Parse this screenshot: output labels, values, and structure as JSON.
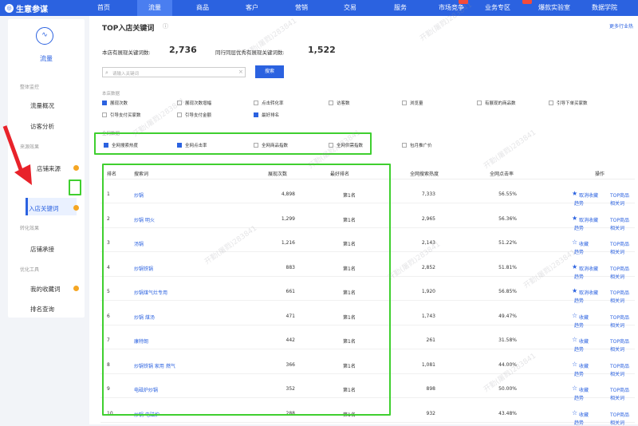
{
  "app": {
    "logo": "生意参谋"
  },
  "nav": [
    "首页",
    "流量",
    "商品",
    "客户",
    "营销",
    "交易",
    "服务",
    "市场竞争",
    "业务专区",
    "爆款实验室",
    "数据学院"
  ],
  "nav_active": 1,
  "sidebar": {
    "title": "流量",
    "sections": [
      "整体监控",
      "来源效果",
      "转化效果",
      "优化工具"
    ],
    "items": [
      "流量概况",
      "访客分析",
      "店铺来源",
      "入店关键词",
      "店铺承接",
      "我的收藏词",
      "排名查询"
    ],
    "active_item": "入店关键词"
  },
  "page": {
    "title": "TOP入店关键词",
    "more_link": "更多行业热",
    "stat1_label": "本店有展现关键词数:",
    "stat1_value": "2,736",
    "stat2_label": "同行同层优秀有展现关键词数:",
    "stat2_value": "1,522",
    "search_placeholder": "请输入关键词",
    "search_button": "搜索",
    "metrics_group_label": "本店数据",
    "metrics_row1": [
      "展现次数",
      "展现次数增幅",
      "点击转化率",
      "访客数",
      "浏览量",
      "有展现的商品数",
      "引导下单买家数"
    ],
    "metrics_row2": [
      "引导支付买家数",
      "引导支付金额",
      "最好排名"
    ],
    "metrics_row1_checked": [
      true,
      false,
      false,
      false,
      false,
      false,
      false
    ],
    "metrics_row2_checked": [
      false,
      false,
      true
    ],
    "global_group_label": "全网数据",
    "global_metrics": [
      "全网搜索热度",
      "全网点击率",
      "全网商品指数",
      "全网供需指数",
      "包月推广价"
    ],
    "global_checked": [
      true,
      true,
      false,
      false,
      false
    ]
  },
  "table": {
    "headers": [
      "排名",
      "搜索词",
      "展现次数",
      "最好排名",
      "全网搜索热度",
      "全网点击率",
      "操作"
    ],
    "rows": [
      {
        "rank": "1",
        "term": "炒锅",
        "impr": "4,898",
        "best": "第1名",
        "heat": "7,333",
        "ctr": "56.55%",
        "fav": "取消收藏",
        "fav_on": true,
        "trend": "趋势",
        "top": "TOP商品",
        "rel": "相关词"
      },
      {
        "rank": "2",
        "term": "炒锅 明火",
        "impr": "1,299",
        "best": "第1名",
        "heat": "2,965",
        "ctr": "56.36%",
        "fav": "取消收藏",
        "fav_on": true,
        "trend": "趋势",
        "top": "TOP商品",
        "rel": "相关词"
      },
      {
        "rank": "3",
        "term": "汤锅",
        "impr": "1,216",
        "best": "第1名",
        "heat": "2,143",
        "ctr": "51.22%",
        "fav": "收藏",
        "fav_on": false,
        "trend": "趋势",
        "top": "TOP商品",
        "rel": "相关词"
      },
      {
        "rank": "4",
        "term": "炒锅铁锅",
        "impr": "883",
        "best": "第1名",
        "heat": "2,852",
        "ctr": "51.81%",
        "fav": "取消收藏",
        "fav_on": true,
        "trend": "趋势",
        "top": "TOP商品",
        "rel": "相关词"
      },
      {
        "rank": "5",
        "term": "炒锅煤气灶专用",
        "impr": "661",
        "best": "第1名",
        "heat": "1,920",
        "ctr": "56.85%",
        "fav": "取消收藏",
        "fav_on": true,
        "trend": "趋势",
        "top": "TOP商品",
        "rel": "相关词"
      },
      {
        "rank": "6",
        "term": "炒锅 煤汤",
        "impr": "471",
        "best": "第1名",
        "heat": "1,743",
        "ctr": "49.47%",
        "fav": "收藏",
        "fav_on": false,
        "trend": "趋势",
        "top": "TOP商品",
        "rel": "相关词"
      },
      {
        "rank": "7",
        "term": "康特朗",
        "impr": "442",
        "best": "第1名",
        "heat": "261",
        "ctr": "31.58%",
        "fav": "收藏",
        "fav_on": false,
        "trend": "趋势",
        "top": "TOP商品",
        "rel": "相关词"
      },
      {
        "rank": "8",
        "term": "炒锅铁锅 家用 燃气",
        "impr": "366",
        "best": "第1名",
        "heat": "1,081",
        "ctr": "44.00%",
        "fav": "收藏",
        "fav_on": false,
        "trend": "趋势",
        "top": "TOP商品",
        "rel": "相关词"
      },
      {
        "rank": "9",
        "term": "电磁炉炒锅",
        "impr": "352",
        "best": "第1名",
        "heat": "898",
        "ctr": "50.00%",
        "fav": "收藏",
        "fav_on": false,
        "trend": "趋势",
        "top": "TOP商品",
        "rel": "相关词"
      },
      {
        "rank": "10",
        "term": "炒锅 电磁炉",
        "impr": "288",
        "best": "第1名",
        "heat": "932",
        "ctr": "43.48%",
        "fav": "收藏",
        "fav_on": false,
        "trend": "趋势",
        "top": "TOP商品",
        "rel": "相关词"
      }
    ]
  },
  "watermark": "开勤(屠戮)283841",
  "colors": {
    "accent": "#2b62e0",
    "highlight": "#3fcf2f",
    "arrow": "#e8222a"
  }
}
